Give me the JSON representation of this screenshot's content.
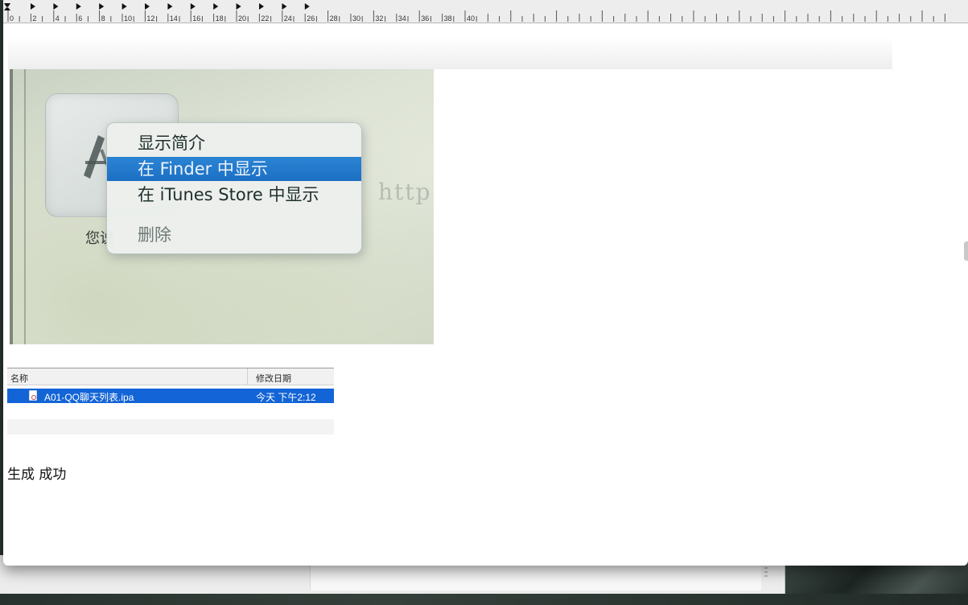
{
  "ruler": {
    "labels": [
      "0",
      "2",
      "4",
      "6",
      "8",
      "10",
      "12",
      "14",
      "16",
      "18",
      "20",
      "22",
      "24",
      "26",
      "28",
      "30",
      "32",
      "34",
      "36",
      "38",
      "40"
    ]
  },
  "photo": {
    "menu_items": [
      "显示简介",
      "在 Finder 中显示",
      "在 iTunes Store 中显示",
      "删除"
    ],
    "selected_item": "在 Finder 中显示",
    "tile_caption": "您说",
    "ghost_text": "http"
  },
  "finder": {
    "columns": {
      "name": "名称",
      "date": "修改日期"
    },
    "row": {
      "file_name": "A01-QQ聊天列表.ipa",
      "modified": "今天 下午2:12",
      "icon": "ipa-file-icon"
    },
    "selection_color": "#1364d6"
  },
  "status": {
    "text": "生成 成功"
  }
}
